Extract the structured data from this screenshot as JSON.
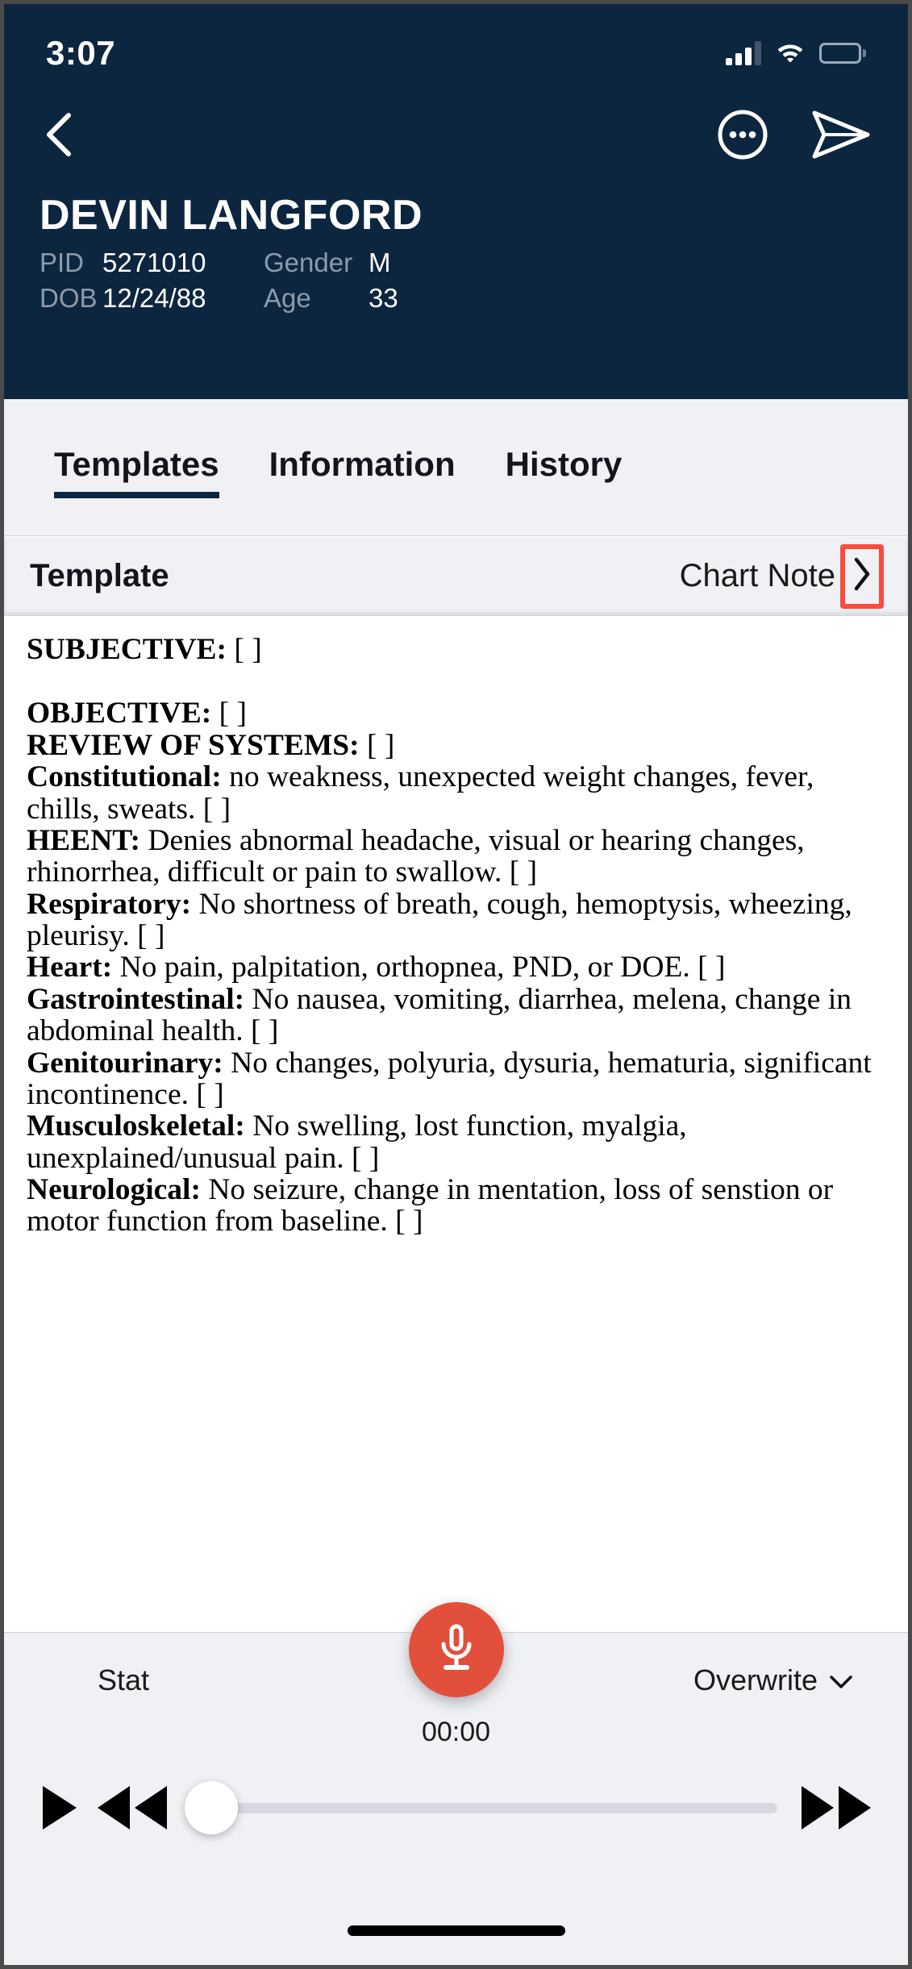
{
  "status_bar": {
    "time": "3:07",
    "cellular_icon": "signal-bars-icon",
    "wifi_icon": "wifi-icon",
    "battery_icon": "battery-full-icon"
  },
  "header": {
    "back_icon": "back-chevron-icon",
    "more_icon": "more-options-icon",
    "send_icon": "send-paper-plane-icon",
    "patient_name": "DEVIN LANGFORD",
    "fields": [
      {
        "label": "PID",
        "value": "5271010"
      },
      {
        "label": "Gender",
        "value": "M"
      },
      {
        "label": "DOB",
        "value": "12/24/88"
      },
      {
        "label": "Age",
        "value": "33"
      }
    ],
    "background_color": "#0d2640"
  },
  "tabs": [
    {
      "label": "Templates",
      "active": true
    },
    {
      "label": "Information",
      "active": false
    },
    {
      "label": "History",
      "active": false
    }
  ],
  "template_row": {
    "label": "Template",
    "value": "Chart Note",
    "chevron_icon": "chevron-right-icon",
    "highlight_color": "#fa4b3c"
  },
  "note": {
    "sections": [
      {
        "heading": "SUBJECTIVE:",
        "text": " [ ]"
      },
      {
        "heading": "",
        "text": ""
      },
      {
        "heading": "OBJECTIVE:",
        "text": " [ ]"
      },
      {
        "heading": "REVIEW OF SYSTEMS:",
        "text": " [ ]"
      },
      {
        "heading": "Constitutional:",
        "text": " no weakness, unexpected weight changes, fever, chills, sweats. [ ]"
      },
      {
        "heading": "HEENT:",
        "text": " Denies abnormal headache, visual or hearing changes, rhinorrhea, difficult or pain to swallow. [ ]"
      },
      {
        "heading": "Respiratory:",
        "text": " No shortness of breath, cough, hemoptysis, wheezing, pleurisy. [ ]"
      },
      {
        "heading": "Heart:",
        "text": " No pain, palpitation, orthopnea, PND, or DOE. [ ]"
      },
      {
        "heading": "Gastrointestinal:",
        "text": " No nausea, vomiting, diarrhea, melena, change in abdominal health. [ ]"
      },
      {
        "heading": "Genitourinary:",
        "text": " No changes, polyuria, dysuria, hematuria, significant incontinence. [ ]"
      },
      {
        "heading": "Musculoskeletal:",
        "text": " No swelling, lost function, myalgia, unexplained/unusual pain. [ ]"
      },
      {
        "heading": "Neurological:",
        "text": " No seizure, change in mentation, loss of senstion or motor function from baseline. [ ]"
      }
    ]
  },
  "mic": {
    "icon": "microphone-icon",
    "color": "#e2503c"
  },
  "footer": {
    "stat_label": "Stat",
    "overwrite_label": "Overwrite",
    "overwrite_chevron_icon": "chevron-down-icon",
    "timer": "00:00",
    "play_icon": "play-icon",
    "rewind_icon": "rewind-icon",
    "forward_icon": "fast-forward-icon",
    "slider_position_percent": 0
  }
}
